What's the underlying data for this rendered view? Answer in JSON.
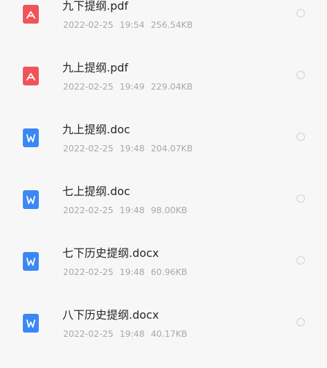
{
  "files": [
    {
      "name": "九下提纲.pdf",
      "date": "2022-02-25",
      "time": "19:54",
      "size": "256.54KB",
      "type": "pdf",
      "icon": "pdf-icon"
    },
    {
      "name": "九上提纲.pdf",
      "date": "2022-02-25",
      "time": "19:49",
      "size": "229.04KB",
      "type": "pdf",
      "icon": "pdf-icon"
    },
    {
      "name": "九上提纲.doc",
      "date": "2022-02-25",
      "time": "19:48",
      "size": "204.07KB",
      "type": "word",
      "icon": "word-icon"
    },
    {
      "name": "七上提纲.doc",
      "date": "2022-02-25",
      "time": "19:48",
      "size": "98.00KB",
      "type": "word",
      "icon": "word-icon"
    },
    {
      "name": "七下历史提纲.docx",
      "date": "2022-02-25",
      "time": "19:48",
      "size": "60.96KB",
      "type": "word",
      "icon": "word-icon"
    },
    {
      "name": "八下历史提纲.docx",
      "date": "2022-02-25",
      "time": "19:48",
      "size": "40.17KB",
      "type": "word",
      "icon": "word-icon"
    }
  ],
  "colors": {
    "pdf": "#f0545a",
    "word": "#3b88f5",
    "background": "#f7f7f7"
  }
}
